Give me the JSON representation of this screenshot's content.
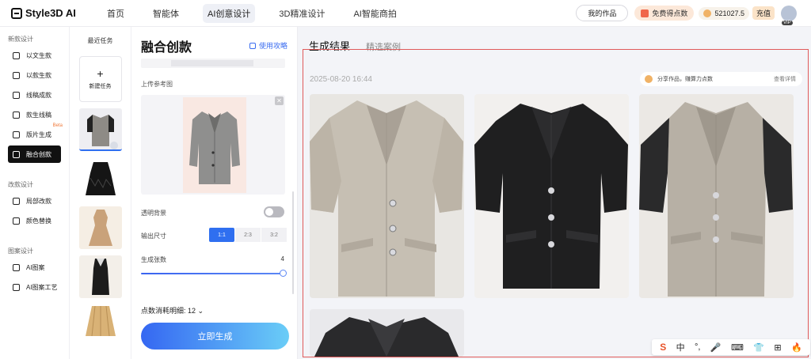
{
  "brand": {
    "name": "Style3D AI"
  },
  "nav": {
    "items": [
      {
        "label": "首页"
      },
      {
        "label": "智能体"
      },
      {
        "label": "AI创意设计"
      },
      {
        "label": "3D精准设计"
      },
      {
        "label": "AI智能商拍"
      }
    ]
  },
  "header": {
    "my_works": "我的作品",
    "free_points": "免费得点数",
    "points_balance": "521027.5",
    "recharge": "充值",
    "vip": "VIP"
  },
  "sidebar": {
    "sections": [
      {
        "title": "新款设计",
        "items": [
          {
            "label": "以文生款"
          },
          {
            "label": "以款生款"
          },
          {
            "label": "线稿成款"
          },
          {
            "label": "款生线稿"
          },
          {
            "label": "版片生成"
          },
          {
            "label": "融合创款"
          }
        ]
      },
      {
        "title": "改款设计",
        "items": [
          {
            "label": "局部改款"
          },
          {
            "label": "颜色替换"
          }
        ]
      },
      {
        "title": "图案设计",
        "items": [
          {
            "label": "AI图案"
          },
          {
            "label": "AI图案工艺"
          }
        ]
      }
    ],
    "beta_label": "Beta"
  },
  "tasks": {
    "title": "最近任务",
    "new_task_label": "新建任务"
  },
  "panel": {
    "title": "融合创款",
    "guide_link": "使用攻略",
    "upload_label": "上传参考图",
    "transparent_bg_label": "透明背景",
    "output_size_label": "输出尺寸",
    "sizes": [
      "1:1",
      "2:3",
      "3:2"
    ],
    "count_label": "生成张数",
    "count_value": "4",
    "count_fraction": 1.0,
    "points_detail": "点数消耗明细: 12",
    "generate_button": "立即生成"
  },
  "result": {
    "tab_active": "生成结果",
    "tab_other": "精选案例",
    "timestamp": "2025-08-20 16:44",
    "share_text": "分享作品，赚算力点数",
    "share_link": "查看详情"
  },
  "ime": {
    "items": [
      "中",
      "°,",
      "🎤",
      "⌨",
      "👕",
      "⊞",
      "🔥"
    ]
  },
  "colors": {
    "accent": "#2f6ff0",
    "frame": "#e05a5a",
    "generate_start": "#3567f2",
    "generate_end": "#6acdf7"
  }
}
